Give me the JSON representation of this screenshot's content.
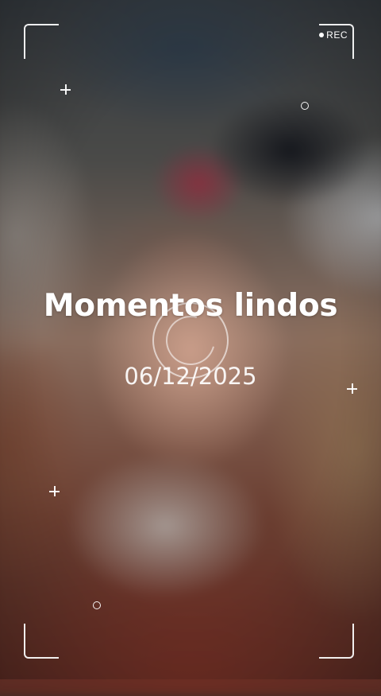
{
  "overlay": {
    "title": "Momentos lindos",
    "date": "06/12/2025",
    "rec_label": "REC"
  },
  "icons": {
    "rec_indicator": "record-dot-icon",
    "focus": "focus-ring-icon",
    "crosshair": "plus-icon",
    "marker": "small-circle-icon"
  },
  "colors": {
    "overlay_text": "#ffffff"
  }
}
